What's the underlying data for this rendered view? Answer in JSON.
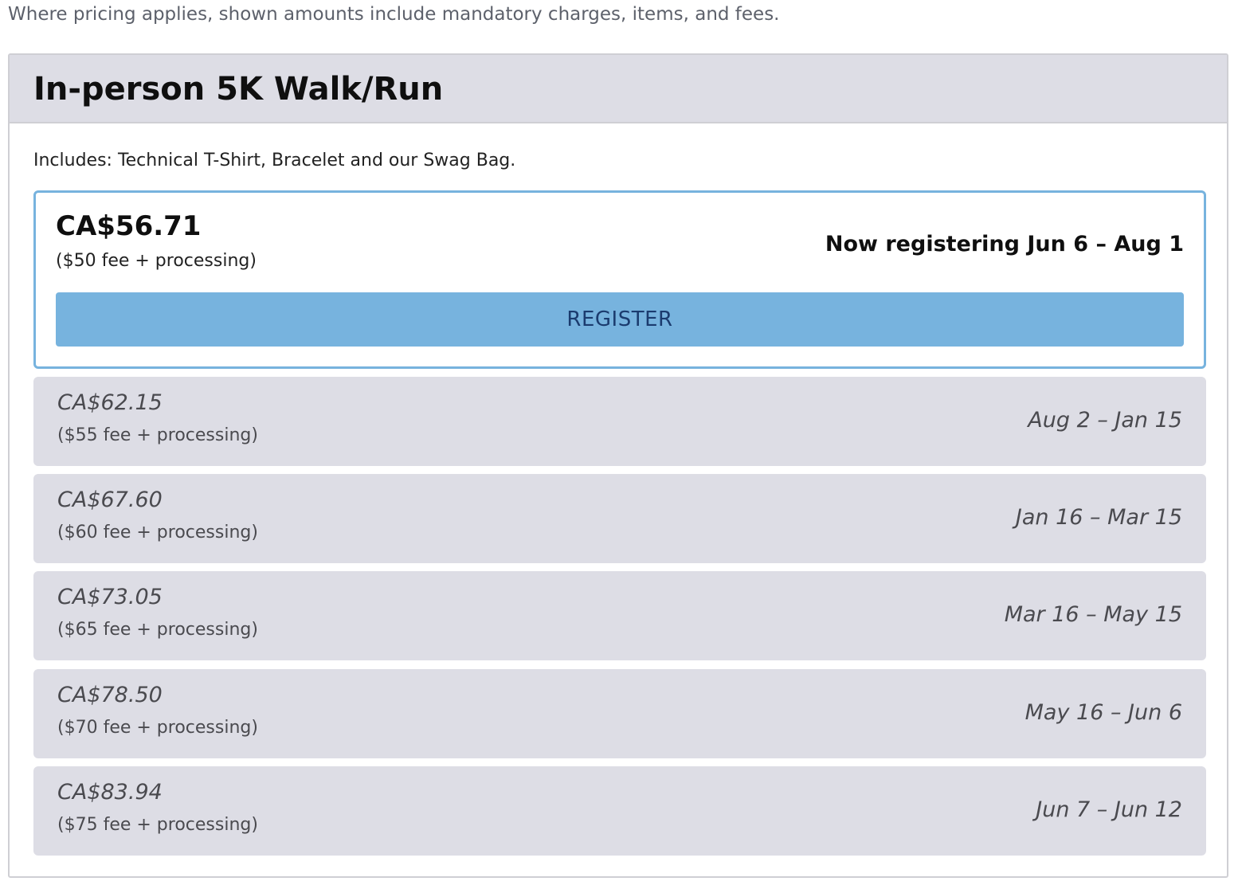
{
  "notice": "Where pricing applies, shown amounts include mandatory charges, items, and fees.",
  "event": {
    "title": "In-person 5K Walk/Run",
    "includes": "Includes: Technical T-Shirt, Bracelet and our Swag Bag."
  },
  "active_tier": {
    "price": "CA$56.71",
    "fee": "($50 fee + processing)",
    "window": "Now registering Jun 6 – Aug 1",
    "register_label": "REGISTER"
  },
  "tiers": [
    {
      "price": "CA$62.15",
      "fee": "($55 fee + processing)",
      "window": "Aug 2 – Jan 15"
    },
    {
      "price": "CA$67.60",
      "fee": "($60 fee + processing)",
      "window": "Jan 16 – Mar 15"
    },
    {
      "price": "CA$73.05",
      "fee": "($65 fee + processing)",
      "window": "Mar 16 – May 15"
    },
    {
      "price": "CA$78.50",
      "fee": "($70 fee + processing)",
      "window": "May 16 – Jun 6"
    },
    {
      "price": "CA$83.94",
      "fee": "($75 fee + processing)",
      "window": "Jun 7 – Jun 12"
    }
  ],
  "colors": {
    "accent": "#77b3de",
    "button_text": "#1b3b6e",
    "tier_background": "#dddde5",
    "header_background": "#dddde5"
  }
}
